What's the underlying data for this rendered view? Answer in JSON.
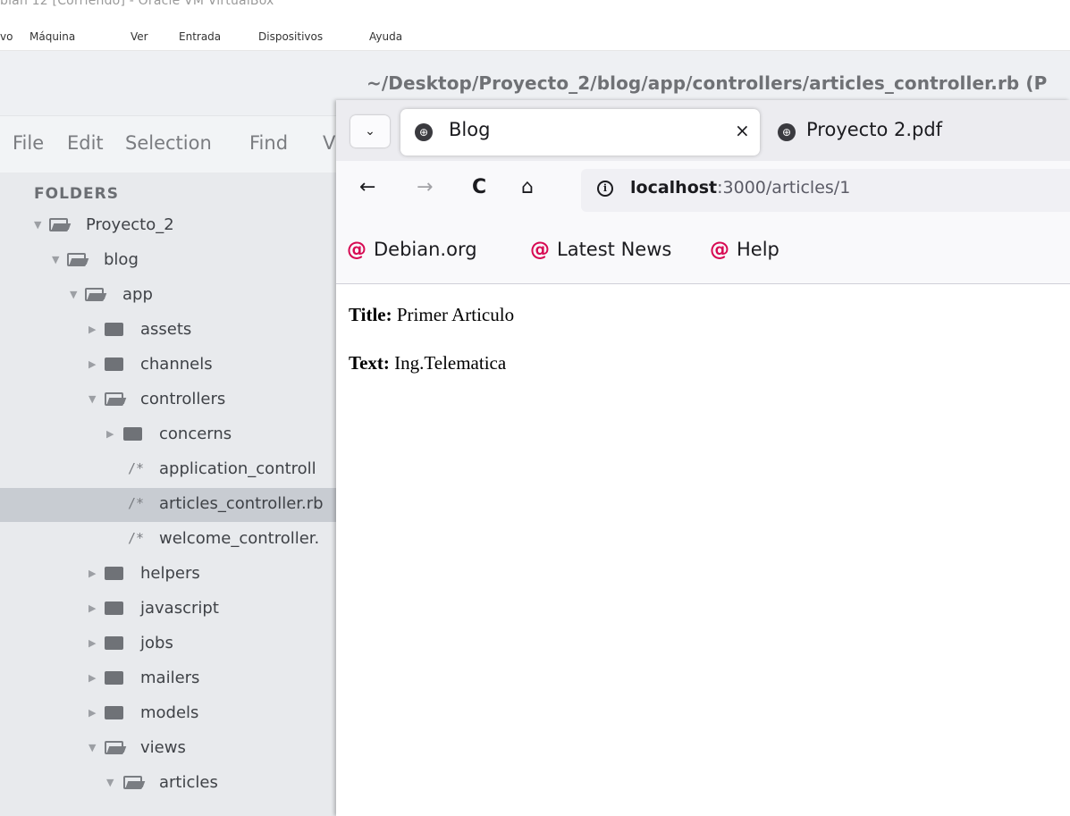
{
  "vbox": {
    "title": "bian 12 [Corriendo] - Oracle VM VirtualBox",
    "menu": [
      "vo",
      "Máquina",
      "Ver",
      "Entrada",
      "Dispositivos",
      "Ayuda"
    ]
  },
  "editor": {
    "title": "~/Desktop/Proyecto_2/blog/app/controllers/articles_controller.rb (P",
    "menu": [
      "File",
      "Edit",
      "Selection",
      "Find",
      "V"
    ],
    "sidebar_header": "FOLDERS",
    "tree": [
      {
        "label": "Proyecto_2",
        "type": "folder-open"
      },
      {
        "label": "blog",
        "type": "folder-open"
      },
      {
        "label": "app",
        "type": "folder-open"
      },
      {
        "label": "assets",
        "type": "folder-closed"
      },
      {
        "label": "channels",
        "type": "folder-closed"
      },
      {
        "label": "controllers",
        "type": "folder-open"
      },
      {
        "label": "concerns",
        "type": "folder-closed"
      },
      {
        "label": "application_controll",
        "type": "file"
      },
      {
        "label": "articles_controller.rb",
        "type": "file",
        "selected": true
      },
      {
        "label": "welcome_controller.",
        "type": "file"
      },
      {
        "label": "helpers",
        "type": "folder-closed"
      },
      {
        "label": "javascript",
        "type": "folder-closed"
      },
      {
        "label": "jobs",
        "type": "folder-closed"
      },
      {
        "label": "mailers",
        "type": "folder-closed"
      },
      {
        "label": "models",
        "type": "folder-closed"
      },
      {
        "label": "views",
        "type": "folder-open"
      },
      {
        "label": "articles",
        "type": "folder-open"
      }
    ],
    "file_icon_glyph": "/*"
  },
  "browser": {
    "list_tabs_glyph": "⌄",
    "tabs": [
      {
        "title": "Blog",
        "active": true,
        "close": "×"
      },
      {
        "title": "Proyecto 2.pdf",
        "active": false
      }
    ],
    "nav": {
      "back": "←",
      "forward": "→",
      "reload": "C",
      "home": "⌂",
      "info": "i"
    },
    "url": {
      "host": "localhost",
      "rest": ":3000/articles/1"
    },
    "bookmarks": [
      "Debian.org",
      "Latest News",
      "Help"
    ],
    "bookmark_glyph": "@",
    "page": {
      "title_label": "Title:",
      "title_value": " Primer Articulo",
      "text_label": "Text:",
      "text_value": " Ing.Telematica"
    }
  },
  "colors": {
    "debian_red": "#d70a53",
    "selected_row": "#c8ccd2",
    "sidebar_bg": "#e8eaed"
  }
}
